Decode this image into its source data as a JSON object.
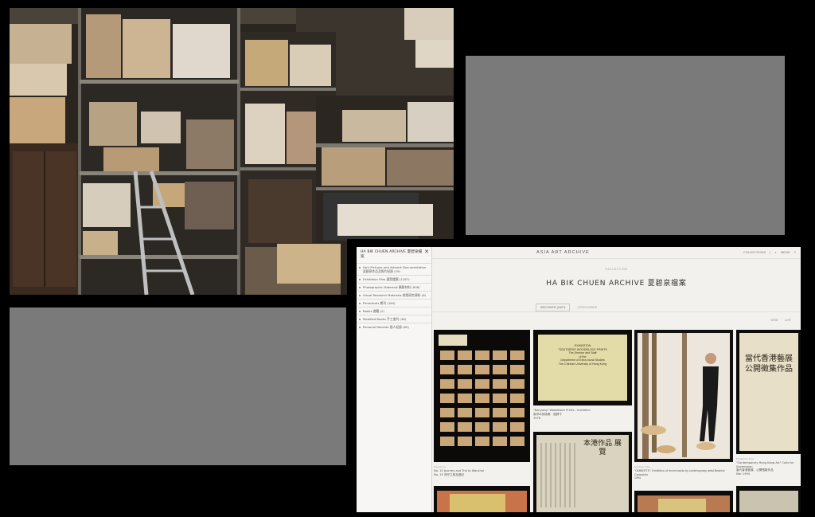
{
  "site": {
    "sidebar": {
      "title": "HA BIK CHUEN ARCHIVE 夏碧泉檔案",
      "close_icon": "close-icon",
      "items": [
        "Ha's Pictures and Artwork Documentation 夏碧泉作品及照片紀錄 (29)",
        "Exhibition Files 展覽檔案 (1187)",
        "Photographic Materials 攝影材料 (906)",
        "Visual Research Materials 視覺研究資料 (6)",
        "Periodicals 期刊 (164)",
        "Books 書籍 (2)",
        "Modified Books 手工書刊 (46)",
        "Personal Records 個人紀錄 (65)"
      ]
    },
    "header": {
      "brand": "ASIA ART ARCHIVE",
      "nav": [
        "COLLECTIONS",
        "|",
        "MENU"
      ],
      "kicker": "COLLECTION",
      "title": "HA BIK CHUEN ARCHIVE 夏碧泉檔案"
    },
    "tabs": [
      {
        "label": "ARCHIVES (2427)",
        "active": true
      },
      {
        "label": "CATEGORIES",
        "active": false
      }
    ],
    "view_options": [
      "GRID",
      "LIST"
    ],
    "items": [
      {
        "kind": "Negatives",
        "title": "No. 15 Journey and Trip to Wanchai",
        "subtitle": "No. 15 灣仔之旅及遊記"
      },
      {
        "kind": "",
        "title": "\"Nanyang\" Woodblock Prints - Invitation",
        "subtitle": "南洋木刻版畫 - 邀請卡",
        "date": "1976",
        "invite_text": "EXHIBITION\n\"SOUTHERN\" WOODBLOCK PRINTS\nThe Director and Staff\nof the\nDepartment of Extra-mural Studies\nThe Chinese University of Hong Kong"
      },
      {
        "kind": "Exhibition Files",
        "title": "\"OMBERTS\": Exhibition of recent works by contemporary artist Beatrice Caracciolo",
        "date": "1994"
      },
      {
        "kind": "Exhibition Files",
        "title": "\"Contemporary Hong Kong Art\" Calls for Submission",
        "subtitle": "當代香港藝展 - 公開徵集作品",
        "date": "Mar 1994",
        "poster_text": "當代香港藝展\n公開徵集作品"
      },
      {
        "kind": "",
        "title": "",
        "poster_text": "本港作品 展覽"
      }
    ]
  }
}
